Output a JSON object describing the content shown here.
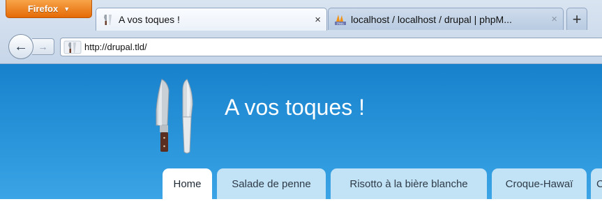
{
  "browser": {
    "menu_button_label": "Firefox",
    "tabs": [
      {
        "title": "A vos toques !",
        "active": true,
        "close": "×",
        "icon": "knives-favicon"
      },
      {
        "title": "localhost / localhost / drupal | phpM...",
        "active": false,
        "close": "×",
        "icon": "phpmyadmin-favicon"
      }
    ],
    "new_tab_label": "+",
    "back_label": "←",
    "forward_label": "→",
    "url": "http://drupal.tld/"
  },
  "site": {
    "name": "A vos toques !",
    "logo_icon": "knives-logo",
    "menu": [
      {
        "label": "Home",
        "active": true
      },
      {
        "label": "Salade de penne",
        "active": false
      },
      {
        "label": "Risotto à la bière blanche",
        "active": false
      },
      {
        "label": "Croque-Hawaï",
        "active": false
      },
      {
        "label": "C",
        "active": false
      }
    ]
  },
  "colors": {
    "banner_top": "#1781cc",
    "banner_bottom": "#3aa4e6",
    "menu_tab": "#c2e2f6",
    "firefox_orange": "#e56a06"
  }
}
